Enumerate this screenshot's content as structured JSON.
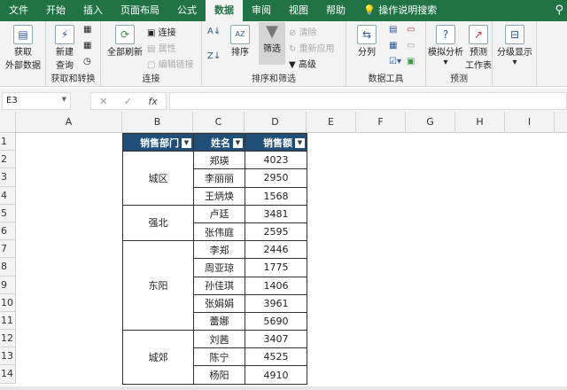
{
  "tabs": [
    "文件",
    "开始",
    "插入",
    "页面布局",
    "公式",
    "数据",
    "审阅",
    "视图",
    "帮助",
    "操作说明搜索"
  ],
  "ribbon": {
    "get_external": "获取",
    "get_external2": "外部数据",
    "new_query": "新建",
    "new_query2": "查询",
    "group1": "获取和转换",
    "refresh_all": "全部刷新",
    "connections": "连接",
    "properties": "属性",
    "edit_links": "编辑链接",
    "group2": "连接",
    "sort": "排序",
    "filter": "筛选",
    "clear": "清除",
    "reapply": "重新应用",
    "advanced": "高级",
    "group3": "排序和筛选",
    "text_to_columns": "分列",
    "group4": "数据工具",
    "what_if": "模拟分析",
    "forecast": "预测",
    "forecast2": "工作表",
    "group5": "预测",
    "outline": "分级显示"
  },
  "formula_bar": {
    "name_box": "E3",
    "formula": ""
  },
  "columns": [
    "A",
    "B",
    "C",
    "D",
    "E",
    "F",
    "G",
    "H",
    "I"
  ],
  "rows": [
    "1",
    "2",
    "3",
    "4",
    "5",
    "6",
    "7",
    "8",
    "9",
    "10",
    "11",
    "12",
    "13",
    "14"
  ],
  "table": {
    "headers": [
      "销售部门",
      "姓名",
      "销售额"
    ],
    "groups": [
      {
        "dept": "城区",
        "rows": [
          [
            "郑瑛",
            "4023"
          ],
          [
            "李丽丽",
            "2950"
          ],
          [
            "王炳焕",
            "1568"
          ]
        ]
      },
      {
        "dept": "强北",
        "rows": [
          [
            "卢廷",
            "3481"
          ],
          [
            "张伟庭",
            "2595"
          ]
        ]
      },
      {
        "dept": "东阳",
        "rows": [
          [
            "李郑",
            "2446"
          ],
          [
            "周亚琼",
            "1775"
          ],
          [
            "孙佳琪",
            "1406"
          ],
          [
            "张娟娟",
            "3961"
          ],
          [
            "蕾娜",
            "5690"
          ]
        ]
      },
      {
        "dept": "城郊",
        "rows": [
          [
            "刘茜",
            "3407"
          ],
          [
            "陈宁",
            "4525"
          ],
          [
            "杨阳",
            "4910"
          ]
        ]
      }
    ]
  }
}
